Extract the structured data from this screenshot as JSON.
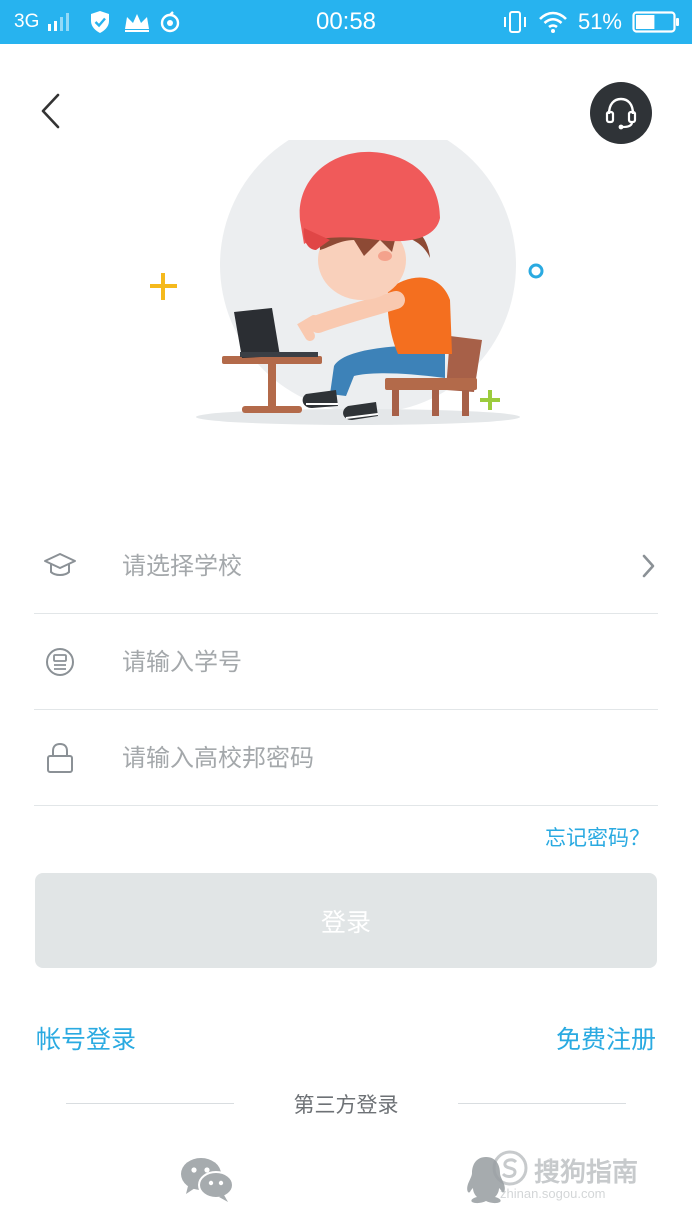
{
  "status_bar": {
    "network": "3G",
    "time": "00:58",
    "battery_percent": "51%",
    "battery_level": 0.51,
    "icons": [
      "signal-icon",
      "shield-icon",
      "crown-icon",
      "netease-icon",
      "vibrate-icon",
      "wifi-icon",
      "battery-icon"
    ]
  },
  "header": {
    "back_icon": "chevron-left-icon",
    "support_icon": "headset-icon"
  },
  "form": {
    "school": {
      "placeholder": "请选择学校",
      "value": "",
      "icon": "graduation-cap-icon"
    },
    "student_id": {
      "placeholder": "请输入学号",
      "value": "",
      "icon": "id-badge-icon"
    },
    "password": {
      "placeholder": "请输入高校邦密码",
      "value": "",
      "icon": "lock-icon"
    }
  },
  "forgot_password": "忘记密码？",
  "login_button": "登录",
  "account_login": "帐号登录",
  "register": "免费注册",
  "third_party": {
    "label": "第三方登录",
    "providers": [
      "wechat-icon",
      "qq-icon"
    ]
  },
  "watermark": {
    "text": "搜狗指南",
    "url": "zhinan.sogou.com"
  },
  "colors": {
    "status_bar": "#27b3ef",
    "link": "#2aaae1",
    "button_disabled": "#e1e5e6",
    "support_button": "#2f3337"
  }
}
